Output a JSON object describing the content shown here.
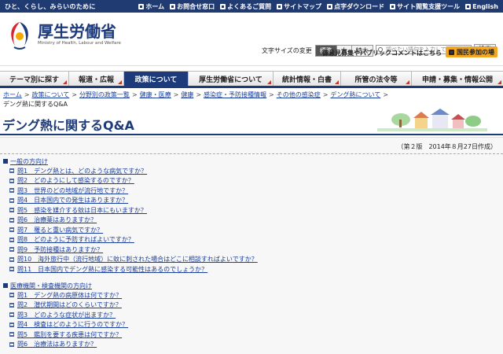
{
  "topbar": {
    "tagline": "ひと、くらし、みらいのために",
    "links": [
      "ホーム",
      "お問合せ窓口",
      "よくあるご質問",
      "サイトマップ",
      "点字ダウンロード",
      "サイト閲覧支援ツール",
      "English"
    ]
  },
  "header": {
    "logo_title": "厚生労働省",
    "logo_sub": "Ministry of Health, Labour and Welfare",
    "fontsize_label": "文字サイズの変更",
    "fontsize_options": [
      "標準",
      "大",
      "特大"
    ],
    "search_placeholder": "調べたい語句を入力して下さい",
    "search_button": "検索",
    "opinion_link": "御意見募集やパブリックコメントはこちら",
    "join_button": "国民参加の場"
  },
  "nav": {
    "tabs": [
      "テーマ別に探す",
      "報道・広報",
      "政策について",
      "厚生労働省について",
      "統計情報・白書",
      "所管の法令等",
      "申請・募集・情報公開"
    ],
    "active_index": 2
  },
  "breadcrumb": {
    "links": [
      "ホーム",
      "政策について",
      "分野別の政策一覧",
      "健康・医療",
      "健康",
      "感染症・予防接種情報",
      "その他の感染症",
      "デング熱について"
    ],
    "current": "デング熱に関するQ&A"
  },
  "page": {
    "title": "デング熱に関するQ&A",
    "edition": "（第２版　2014年８月27日作成）"
  },
  "sections": [
    {
      "heading": "一般の方向け",
      "questions": [
        "問1　デング熱とは、どのような病気ですか？",
        "問2　どのようにして感染するのですか？",
        "問3　世界のどの地域が流行地ですか？",
        "問4　日本国内での発生はありますか？",
        "問5　感染を媒介する蚊は日本にもいますか？",
        "問6　治療薬はありますか？",
        "問7　罹ると重い病気ですか？",
        "問8　どのように予防すればよいですか？",
        "問9　予防接種はありますか？",
        "問10　海外旅行中（流行地域）に蚊に刺された場合はどこに相談すればよいですか？",
        "問11　日本国内でデング熱に感染する可能性はあるのでしょうか？"
      ]
    },
    {
      "heading": "医療機関・検査機関の方向け",
      "questions": [
        "問1　デング熱の病原体は何ですか？",
        "問2　潜伏期間はどのくらいですか？",
        "問3　どのような症状が出ますか？",
        "問4　検査はどのように行うのですか？",
        "問5　鑑別を要する疾患は何ですか？",
        "問6　治療法はありますか？"
      ]
    }
  ]
}
